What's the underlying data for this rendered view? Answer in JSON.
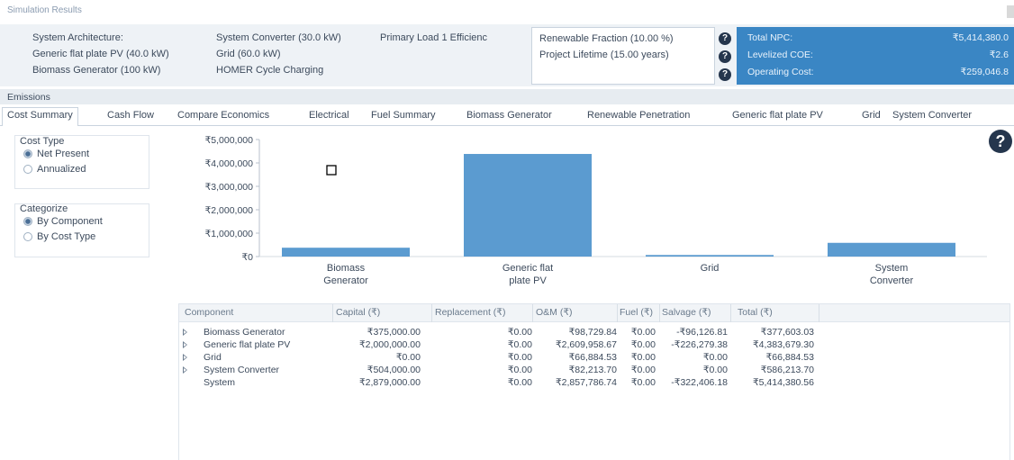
{
  "window": {
    "title": "Simulation Results"
  },
  "architecture": {
    "label": "System Architecture:",
    "col1": [
      "Generic flat plate PV (40.0 kW)",
      "Biomass Generator (100 kW)"
    ],
    "col2": [
      "System Converter (30.0 kW)",
      "Grid (60.0 kW)",
      "HOMER Cycle Charging"
    ],
    "col3": "Primary Load 1 Efficienc"
  },
  "metrics": [
    {
      "label": "Renewable Fraction (10.00 %)"
    },
    {
      "label": "Project Lifetime (15.00 years)"
    },
    {
      "label": ""
    }
  ],
  "summary": [
    {
      "label": "Total NPC:",
      "value": "₹5,414,380.0"
    },
    {
      "label": "Levelized COE:",
      "value": "₹2.6"
    },
    {
      "label": "Operating Cost:",
      "value": "₹259,046.8"
    }
  ],
  "help_glyph": "?",
  "emissions_label": "Emissions",
  "tabs": [
    "Cost Summary",
    "Cash Flow",
    "Compare Economics",
    "Electrical",
    "Fuel Summary",
    "Biomass Generator",
    "Renewable Penetration",
    "Generic flat plate PV",
    "Grid",
    "System Converter"
  ],
  "active_tab": 0,
  "cost_type": {
    "title": "Cost Type",
    "options": [
      "Net Present",
      "Annualized"
    ],
    "selected": 0
  },
  "categorize": {
    "title": "Categorize",
    "options": [
      "By Component",
      "By Cost Type"
    ],
    "selected": 0
  },
  "colors": {
    "accent": "#3a86c4",
    "bar": "#5b9bd0",
    "dark": "#25364d"
  },
  "chart_data": {
    "type": "bar",
    "categories": [
      [
        "Biomass",
        "Generator"
      ],
      [
        "Generic flat",
        "plate PV"
      ],
      [
        "Grid"
      ],
      [
        "System",
        "Converter"
      ]
    ],
    "values": [
      377603.03,
      4383679.3,
      66884.53,
      586213.7
    ],
    "yticks": [
      "₹0",
      "₹1,000,000",
      "₹2,000,000",
      "₹3,000,000",
      "₹4,000,000",
      "₹5,000,000"
    ],
    "ylim": [
      0,
      5000000
    ],
    "grid": false
  },
  "table": {
    "headers": [
      "Component",
      "Capital (₹)",
      "Replacement (₹)",
      "O&M (₹)",
      "Fuel (₹)",
      "Salvage (₹)",
      "Total (₹)"
    ],
    "rows": [
      {
        "expandable": true,
        "cells": [
          "Biomass Generator",
          "₹375,000.00",
          "₹0.00",
          "₹98,729.84",
          "₹0.00",
          "-₹96,126.81",
          "₹377,603.03"
        ]
      },
      {
        "expandable": true,
        "cells": [
          "Generic flat plate PV",
          "₹2,000,000.00",
          "₹0.00",
          "₹2,609,958.67",
          "₹0.00",
          "-₹226,279.38",
          "₹4,383,679.30"
        ]
      },
      {
        "expandable": true,
        "cells": [
          "Grid",
          "₹0.00",
          "₹0.00",
          "₹66,884.53",
          "₹0.00",
          "₹0.00",
          "₹66,884.53"
        ]
      },
      {
        "expandable": true,
        "cells": [
          "System Converter",
          "₹504,000.00",
          "₹0.00",
          "₹82,213.70",
          "₹0.00",
          "₹0.00",
          "₹586,213.70"
        ]
      },
      {
        "expandable": false,
        "cells": [
          "System",
          "₹2,879,000.00",
          "₹0.00",
          "₹2,857,786.74",
          "₹0.00",
          "-₹322,406.18",
          "₹5,414,380.56"
        ]
      }
    ]
  }
}
